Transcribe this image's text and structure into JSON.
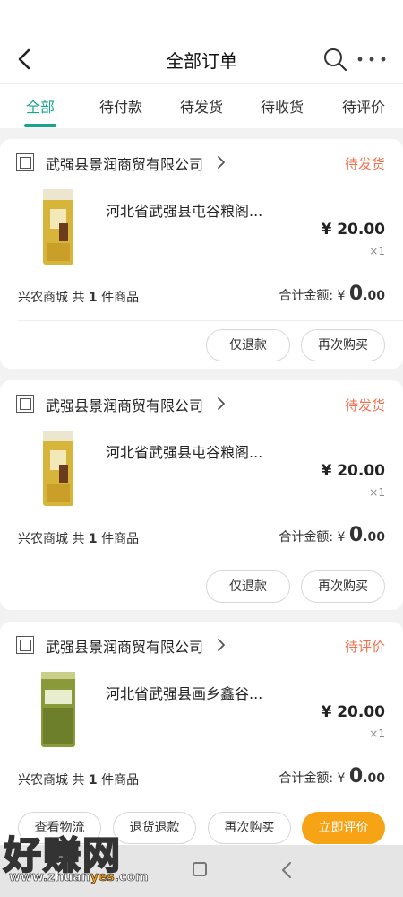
{
  "header": {
    "title": "全部订单"
  },
  "tabs": [
    {
      "label": "全部"
    },
    {
      "label": "待付款"
    },
    {
      "label": "待发货"
    },
    {
      "label": "待收货"
    },
    {
      "label": "待评价"
    }
  ],
  "orders": [
    {
      "store": "武强县景润商贸有限公司",
      "status": "待发货",
      "product": "河北省武强县屯谷粮阁...",
      "price": "¥ 20.00",
      "qty": "×1",
      "summary_prefix": "兴农商城 共 ",
      "count": "1",
      "summary_suffix": " 件商品",
      "total_label": "合计金额: ¥ ",
      "total_int": "0",
      "total_dec": ".00",
      "buttons": [
        "仅退款",
        "再次购买"
      ]
    },
    {
      "store": "武强县景润商贸有限公司",
      "status": "待发货",
      "product": "河北省武强县屯谷粮阁...",
      "price": "¥ 20.00",
      "qty": "×1",
      "summary_prefix": "兴农商城 共 ",
      "count": "1",
      "summary_suffix": " 件商品",
      "total_label": "合计金额: ¥ ",
      "total_int": "0",
      "total_dec": ".00",
      "buttons": [
        "仅退款",
        "再次购买"
      ]
    },
    {
      "store": "武强县景润商贸有限公司",
      "status": "待评价",
      "product": "河北省武强县画乡鑫谷...",
      "price": "¥ 20.00",
      "qty": "×1",
      "summary_prefix": "兴农商城 共 ",
      "count": "1",
      "summary_suffix": " 件商品",
      "total_label": "合计金额: ¥ ",
      "total_int": "0",
      "total_dec": ".00",
      "buttons": [
        "查看物流",
        "退货退款",
        "再次购买",
        "立即评价"
      ]
    }
  ],
  "watermark": {
    "big": "好赚网",
    "small_a": "www.zhuan",
    "small_b": "yes",
    "small_c": ".com"
  },
  "colors": {
    "accent": "#19a58d",
    "status": "#f26f4e",
    "primary_button": "#f7a316"
  }
}
